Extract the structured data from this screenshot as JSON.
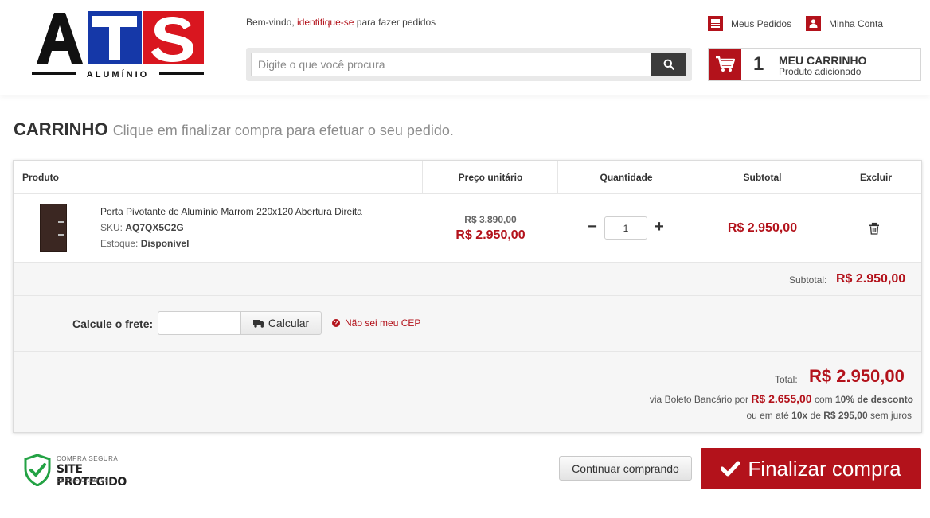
{
  "header": {
    "logo_text": "ATS",
    "logo_subtext": "ALUMÍNIO",
    "welcome_prefix": "Bem-vindo,",
    "welcome_link": "identifique-se",
    "welcome_suffix": "para fazer pedidos",
    "search_placeholder": "Digite o que você procura",
    "my_orders": "Meus Pedidos",
    "my_account": "Minha Conta",
    "cart_count": "1",
    "cart_title": "MEU CARRINHO",
    "cart_status": "Produto adicionado"
  },
  "page": {
    "title": "CARRINHO",
    "subtitle": "Clique em finalizar compra para efetuar o seu pedido."
  },
  "table": {
    "headers": {
      "product": "Produto",
      "unit_price": "Preço unitário",
      "quantity": "Quantidade",
      "subtotal": "Subtotal",
      "remove": "Excluir"
    },
    "items": [
      {
        "name": "Porta Pivotante de Alumínio Marrom 220x120 Abertura Direita",
        "sku_label": "SKU:",
        "sku": "AQ7QX5C2G",
        "stock_label": "Estoque:",
        "stock": "Disponível",
        "old_price": "R$ 3.890,00",
        "price": "R$ 2.950,00",
        "quantity": "1",
        "subtotal": "R$ 2.950,00"
      }
    ],
    "qty_minus": "−",
    "qty_plus": "+"
  },
  "summary": {
    "subtotal_label": "Subtotal:",
    "subtotal_value": "R$ 2.950,00",
    "shipping_label": "Calcule o frete:",
    "calc_button": "Calcular",
    "unknown_cep": "Não sei meu CEP",
    "total_label": "Total:",
    "total_value": "R$ 2.950,00",
    "boleto_prefix": "via Boleto Bancário por",
    "boleto_value": "R$ 2.655,00",
    "boleto_mid": "com",
    "boleto_discount": "10% de desconto",
    "installments_prefix": "ou em até",
    "installments_count": "10x",
    "installments_mid": "de",
    "installments_value": "R$ 295,00",
    "installments_suffix": "sem juros"
  },
  "footer": {
    "seal_top": "COMPRA SEGURA",
    "seal_main": "SITE PROTEGIDO",
    "seal_bottom": "CERTIFICADO SSL",
    "continue_button": "Continuar comprando",
    "checkout_button": "Finalizar compra"
  },
  "colors": {
    "brand_red": "#b3121b",
    "brand_blue": "#1538a8",
    "text_dark": "#333333"
  }
}
